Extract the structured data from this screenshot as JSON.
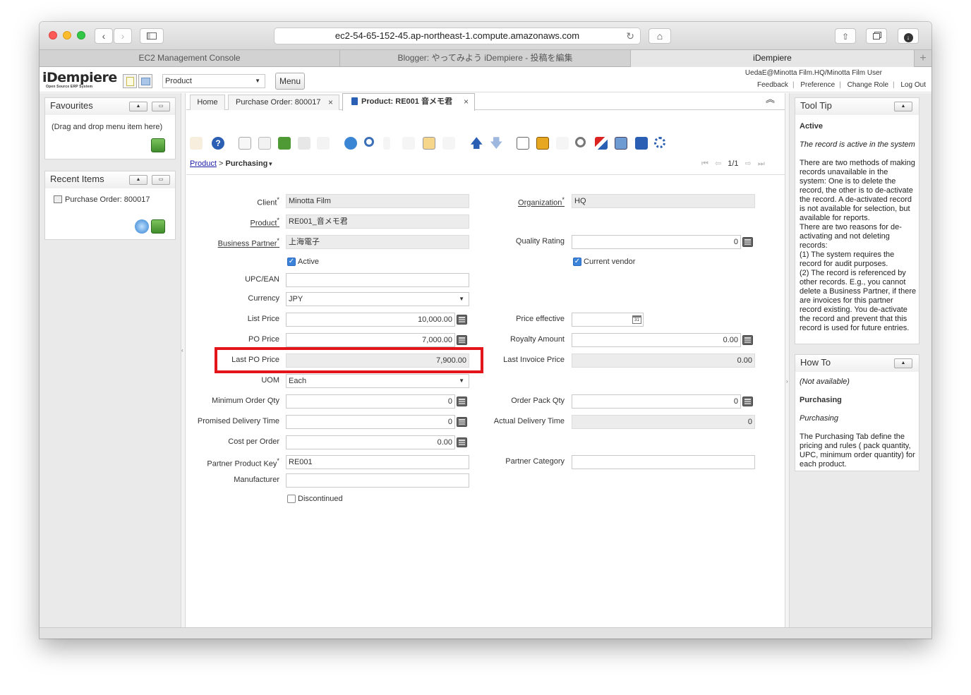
{
  "browser": {
    "url": "ec2-54-65-152-45.ap-northeast-1.compute.amazonaws.com",
    "tabs": [
      "EC2 Management Console",
      "Blogger: やってみよう iDempiere - 投稿を編集",
      "iDempiere"
    ],
    "new_tab_label": "+"
  },
  "header": {
    "logo": "iDempiere",
    "logo_sub": "Open Source ERP System",
    "search_value": "Product",
    "menu_label": "Menu",
    "user": "UedaE@Minotta Film.HQ/Minotta Film User",
    "links": [
      "Feedback",
      "Preference",
      "Change Role",
      "Log Out"
    ]
  },
  "favourites": {
    "title": "Favourites",
    "hint": "(Drag and drop menu item here)"
  },
  "recent": {
    "title": "Recent Items",
    "items": [
      "Purchase Order: 800017"
    ]
  },
  "app_tabs": [
    {
      "label": "Home",
      "closable": false
    },
    {
      "label": "Purchase Order: 800017",
      "closable": true
    },
    {
      "label": "Product: RE001 音メモ君",
      "closable": true
    }
  ],
  "close_glyph": "×",
  "breadcrumb": {
    "parent": "Product",
    "separator": ">",
    "current": "Purchasing"
  },
  "record_nav": "1/1",
  "form": {
    "client": {
      "label": "Client",
      "value": "Minotta Film"
    },
    "organization": {
      "label": "Organization",
      "value": "HQ"
    },
    "product": {
      "label": "Product",
      "value": "RE001_音メモ君"
    },
    "business_partner": {
      "label": "Business Partner",
      "value": "上海電子"
    },
    "quality_rating": {
      "label": "Quality Rating",
      "value": "0"
    },
    "active": {
      "label": "Active",
      "checked": true
    },
    "current_vendor": {
      "label": "Current vendor",
      "checked": true
    },
    "upc": {
      "label": "UPC/EAN",
      "value": ""
    },
    "currency": {
      "label": "Currency",
      "value": "JPY"
    },
    "list_price": {
      "label": "List Price",
      "value": "10,000.00"
    },
    "price_effective": {
      "label": "Price effective",
      "value": "",
      "icon": "31"
    },
    "po_price": {
      "label": "PO Price",
      "value": "7,000.00"
    },
    "royalty_amount": {
      "label": "Royalty Amount",
      "value": "0.00"
    },
    "last_po_price": {
      "label": "Last PO Price",
      "value": "7,900.00"
    },
    "last_invoice_price": {
      "label": "Last Invoice Price",
      "value": "0.00"
    },
    "uom": {
      "label": "UOM",
      "value": "Each"
    },
    "min_order_qty": {
      "label": "Minimum Order Qty",
      "value": "0"
    },
    "order_pack_qty": {
      "label": "Order Pack Qty",
      "value": "0"
    },
    "promised_delivery": {
      "label": "Promised Delivery Time",
      "value": "0"
    },
    "actual_delivery": {
      "label": "Actual Delivery Time",
      "value": "0"
    },
    "cost_per_order": {
      "label": "Cost per Order",
      "value": "0.00"
    },
    "partner_product_key": {
      "label": "Partner Product Key",
      "value": "RE001"
    },
    "partner_category": {
      "label": "Partner Category",
      "value": ""
    },
    "manufacturer": {
      "label": "Manufacturer",
      "value": ""
    },
    "discontinued": {
      "label": "Discontinued",
      "checked": false
    }
  },
  "tooltip": {
    "title": "Tool Tip",
    "field": "Active",
    "summary": "The record is active in the system",
    "body": "There are two methods of making records unavailable in the system: One is to delete the record, the other is to de-activate the record. A de-activated record is not available for selection, but available for reports.\nThere are two reasons for de-activating and not deleting records:\n(1) The system requires the record for audit purposes.\n(2) The record is referenced by other records. E.g., you cannot delete a Business Partner, if there are invoices for this partner record existing. You de-activate the record and prevent that this record is used for future entries."
  },
  "howto": {
    "title": "How To",
    "status": "(Not available)",
    "tab_name": "Purchasing",
    "tab_name_italic": "Purchasing",
    "description": "The Purchasing Tab define the pricing and rules ( pack quantity, UPC, minimum order quantity) for each product."
  },
  "colors": {
    "highlight_box": "#e3151a",
    "link": "#1a1aa6",
    "toolbar_blue": "#2b5fb3"
  }
}
